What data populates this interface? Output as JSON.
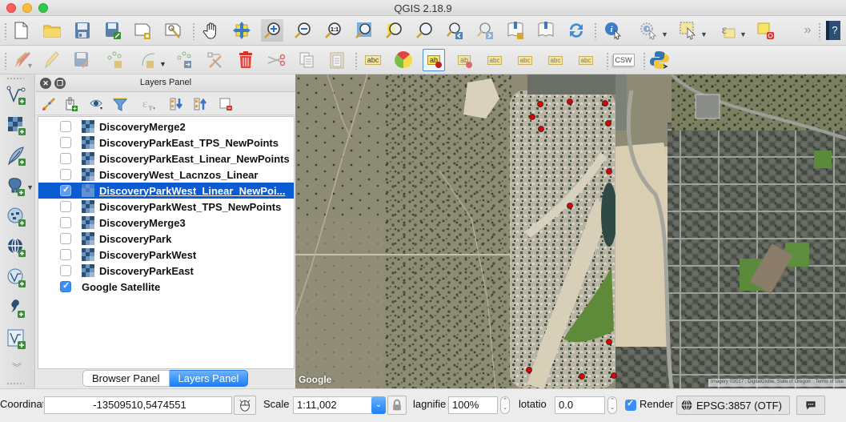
{
  "window": {
    "title": "QGIS 2.18.9"
  },
  "toolbar1": {
    "buttons": [
      {
        "name": "new-project",
        "tooltip": "New Project"
      },
      {
        "name": "open-project",
        "tooltip": "Open Project"
      },
      {
        "name": "save-project",
        "tooltip": "Save Project"
      },
      {
        "name": "save-project-as",
        "tooltip": "Save Project As"
      },
      {
        "name": "new-print-composer",
        "tooltip": "New Print Composer"
      },
      {
        "name": "composer-manager",
        "tooltip": "Composer Manager"
      },
      {
        "name": "pan-map",
        "tooltip": "Pan Map"
      },
      {
        "name": "pan-to-selection",
        "tooltip": "Pan Map to Selection"
      },
      {
        "name": "zoom-in",
        "tooltip": "Zoom In",
        "active": true
      },
      {
        "name": "zoom-out",
        "tooltip": "Zoom Out"
      },
      {
        "name": "zoom-native",
        "tooltip": "Zoom to Native Resolution",
        "glyph": "1:1"
      },
      {
        "name": "zoom-full",
        "tooltip": "Zoom Full"
      },
      {
        "name": "zoom-to-selection",
        "tooltip": "Zoom to Selection"
      },
      {
        "name": "zoom-to-layer",
        "tooltip": "Zoom to Layer"
      },
      {
        "name": "zoom-last",
        "tooltip": "Zoom Last"
      },
      {
        "name": "zoom-next",
        "tooltip": "Zoom Next"
      },
      {
        "name": "new-bookmark",
        "tooltip": "New Bookmark"
      },
      {
        "name": "show-bookmarks",
        "tooltip": "Show Bookmarks"
      },
      {
        "name": "refresh",
        "tooltip": "Refresh"
      },
      {
        "name": "identify-features",
        "tooltip": "Identify Features"
      },
      {
        "name": "run-feature-action",
        "tooltip": "Run Feature Action"
      },
      {
        "name": "select-features",
        "tooltip": "Select Features"
      },
      {
        "name": "select-by-expression",
        "tooltip": "Select by Expression"
      },
      {
        "name": "deselect-all",
        "tooltip": "Deselect Features"
      },
      {
        "name": "overflow",
        "glyph": "»"
      },
      {
        "name": "help",
        "glyph": "?"
      }
    ]
  },
  "toolbar2": {
    "buttons": [
      {
        "name": "current-edits",
        "tooltip": "Current Edits"
      },
      {
        "name": "toggle-editing",
        "tooltip": "Toggle Editing"
      },
      {
        "name": "save-layer-edits",
        "tooltip": "Save Layer Edits"
      },
      {
        "name": "add-feature",
        "tooltip": "Add Feature"
      },
      {
        "name": "add-circular-string",
        "tooltip": "Add Circular String"
      },
      {
        "name": "move-feature",
        "tooltip": "Move Feature"
      },
      {
        "name": "node-tool",
        "tooltip": "Node Tool"
      },
      {
        "name": "delete-selected",
        "tooltip": "Delete Selected"
      },
      {
        "name": "cut-features",
        "tooltip": "Cut Features"
      },
      {
        "name": "copy-features",
        "tooltip": "Copy Features"
      },
      {
        "name": "paste-features",
        "tooltip": "Paste Features"
      },
      {
        "name": "layer-labeling",
        "glyph": "abc"
      },
      {
        "name": "layer-diagram",
        "tooltip": "Layer Diagram Options"
      },
      {
        "name": "highlight-pinned-labels",
        "glyph": "ab",
        "active": true
      },
      {
        "name": "pin-unpin-labels",
        "glyph": "ab"
      },
      {
        "name": "show-hide-labels",
        "glyph": "abc"
      },
      {
        "name": "move-label",
        "glyph": "abc"
      },
      {
        "name": "rotate-label",
        "glyph": "abc"
      },
      {
        "name": "change-label",
        "glyph": "abc"
      },
      {
        "name": "csw-metasearch",
        "glyph": "CSW"
      },
      {
        "name": "python-console",
        "tooltip": "Python Console"
      }
    ]
  },
  "left_toolbar": {
    "buttons": [
      {
        "name": "add-vector-layer"
      },
      {
        "name": "add-raster-layer"
      },
      {
        "name": "add-spatialite-layer"
      },
      {
        "name": "add-postgis-layer"
      },
      {
        "name": "add-wms-layer"
      },
      {
        "name": "add-wcs-layer"
      },
      {
        "name": "add-wfs-layer"
      },
      {
        "name": "add-delimited-text-layer"
      },
      {
        "name": "new-shapefile-layer"
      },
      {
        "name": "more-tools",
        "glyph": "»"
      }
    ]
  },
  "layers_panel": {
    "title": "Layers Panel",
    "layers": [
      {
        "name": "DiscoveryMerge2",
        "checked": false,
        "type": "raster",
        "selected": false
      },
      {
        "name": "DiscoveryParkEast_TPS_NewPoints",
        "checked": false,
        "type": "raster",
        "selected": false
      },
      {
        "name": "DiscoveryParkEast_Linear_NewPoints",
        "checked": false,
        "type": "raster",
        "selected": false
      },
      {
        "name": "DiscoveryWest_Lacnzos_Linear",
        "checked": false,
        "type": "raster",
        "selected": false
      },
      {
        "name": "DiscoveryParkWest_Linear_NewPoi...",
        "checked": true,
        "type": "raster",
        "selected": true
      },
      {
        "name": "DiscoveryParkWest_TPS_NewPoints",
        "checked": false,
        "type": "raster",
        "selected": false
      },
      {
        "name": "DiscoveryMerge3",
        "checked": false,
        "type": "raster",
        "selected": false
      },
      {
        "name": "DiscoveryPark",
        "checked": false,
        "type": "raster",
        "selected": false
      },
      {
        "name": "DiscoveryParkWest",
        "checked": false,
        "type": "raster",
        "selected": false
      },
      {
        "name": "DiscoveryParkEast",
        "checked": false,
        "type": "raster",
        "selected": false
      },
      {
        "name": "Google Satellite",
        "checked": true,
        "type": "tile",
        "selected": false
      }
    ],
    "tabs": [
      {
        "label": "Browser Panel",
        "active": false
      },
      {
        "label": "Layers Panel",
        "active": true
      }
    ]
  },
  "map": {
    "logo": "Google",
    "attribution": "Imagery ©2017 , DigitalGlobe, State of Oregon",
    "terms": "Terms of Use",
    "marker_color": "#e00000"
  },
  "statusbar": {
    "coordinate_label": "Coordinat",
    "coordinate_value": "-13509510,5474551",
    "scale_label": "Scale",
    "scale_value": "1:11,002",
    "magnifier_label": "lagnifie",
    "magnifier_value": "100%",
    "rotation_label": "lotatio",
    "rotation_value": "0.0",
    "render_label": "Render",
    "render_checked": true,
    "crs_label": "EPSG:3857 (OTF)"
  },
  "colors": {
    "selection": "#0b5bd3",
    "accent": "#1b7ff6",
    "checkbox": "#3a8ef7"
  }
}
